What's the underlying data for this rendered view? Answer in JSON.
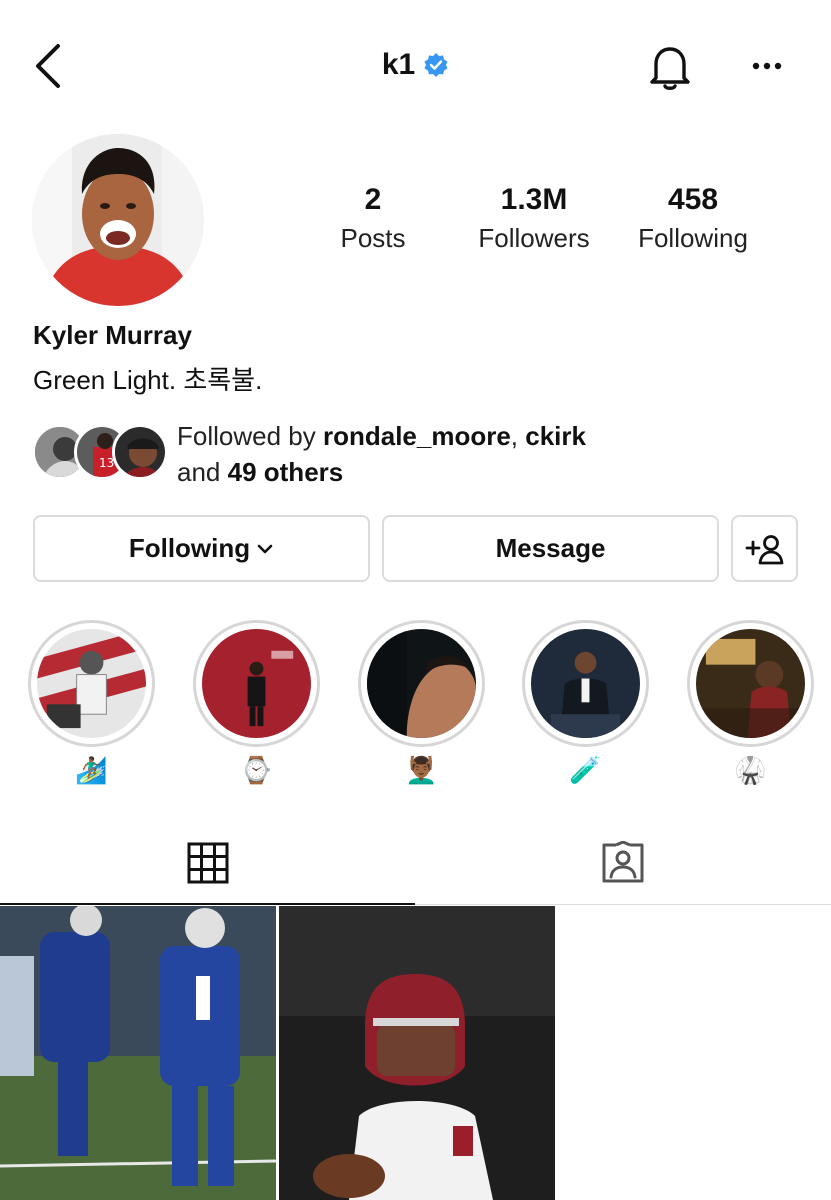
{
  "header": {
    "username": "k1",
    "verified": true,
    "icons": [
      "back-icon",
      "verified-badge-icon",
      "bell-icon",
      "more-options-icon"
    ]
  },
  "profile": {
    "full_name": "Kyler Murray",
    "bio": "Green Light. 초록불.",
    "stats": [
      {
        "value": "2",
        "label": "Posts"
      },
      {
        "value": "1.3M",
        "label": "Followers"
      },
      {
        "value": "458",
        "label": "Following"
      }
    ]
  },
  "followed_by": {
    "prefix": "Followed by",
    "users": [
      "rondale_moore",
      "ckirk"
    ],
    "separator": ",",
    "and_text": "and",
    "others": "49 others"
  },
  "actions": {
    "following_label": "Following",
    "message_label": "Message"
  },
  "highlights": [
    {
      "label": "🏄🏾‍♂️"
    },
    {
      "label": "⌚️"
    },
    {
      "label": "💆🏾‍♂️"
    },
    {
      "label": "🧪"
    },
    {
      "label": "🥋"
    }
  ],
  "tabs": [
    "posts-grid-tab",
    "tagged-tab"
  ],
  "colors": {
    "verified_blue": "#3897f0",
    "border_gray": "#dbdbdb",
    "text": "#111111"
  }
}
